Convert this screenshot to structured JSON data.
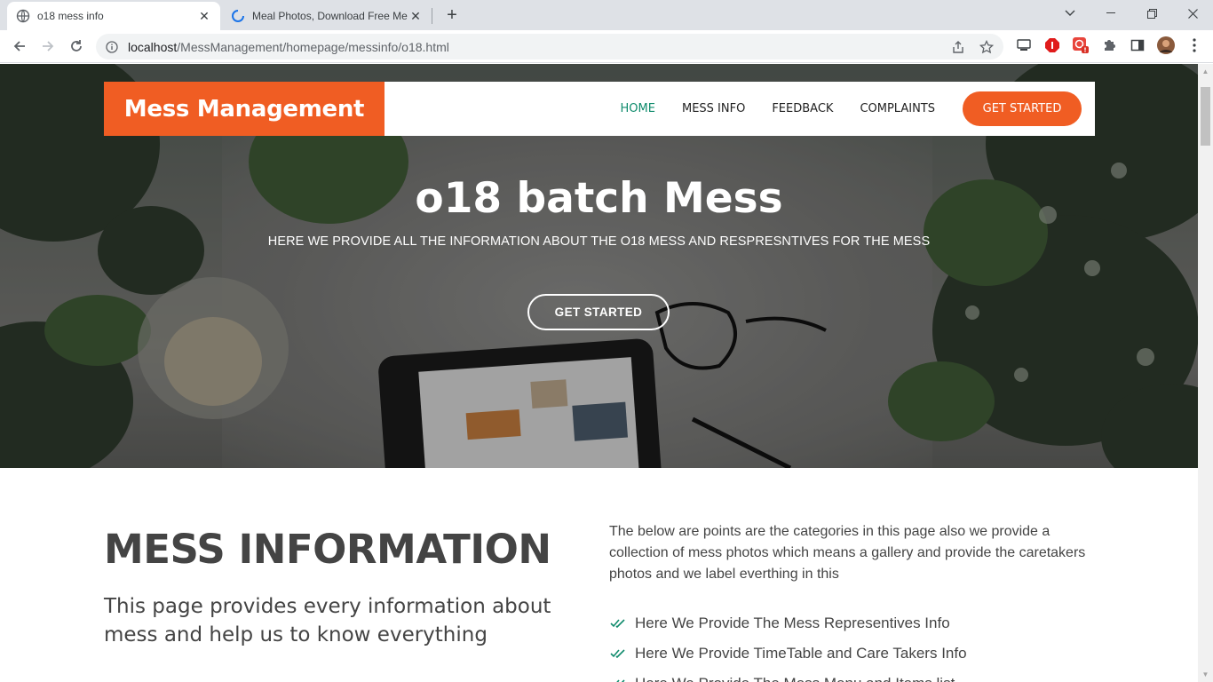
{
  "browser": {
    "tabs": [
      {
        "title": "o18 mess info",
        "active": true
      },
      {
        "title": "Meal Photos, Download Free Me",
        "active": false
      }
    ],
    "url_host": "localhost",
    "url_path": "/MessManagement/homepage/messinfo/o18.html"
  },
  "header": {
    "logo": "Mess Management",
    "nav": [
      "HOME",
      "MESS INFO",
      "FEEDBACK",
      "COMPLAINTS"
    ],
    "cta": "GET STARTED"
  },
  "hero": {
    "title": "o18 batch Mess",
    "subtitle": "HERE WE PROVIDE ALL THE INFORMATION ABOUT THE O18 MESS AND RESPRESNTIVES FOR THE MESS",
    "button": "GET STARTED"
  },
  "info": {
    "title": "MESS INFORMATION",
    "lead": "This page provides every information about mess and help us to know everything",
    "description": "The below are points are the categories in this page also we provide a collection of mess photos which means a gallery and provide the caretakers photos and we label everthing in this",
    "items": [
      "Here We Provide The Mess Representives Info",
      "Here We Provide TimeTable and Care Takers Info",
      "Here We Provide The Mess Menu and Items list"
    ]
  },
  "colors": {
    "brand": "#f05d23",
    "nav_active": "#0f8b6c",
    "check": "#0f8b6c"
  }
}
